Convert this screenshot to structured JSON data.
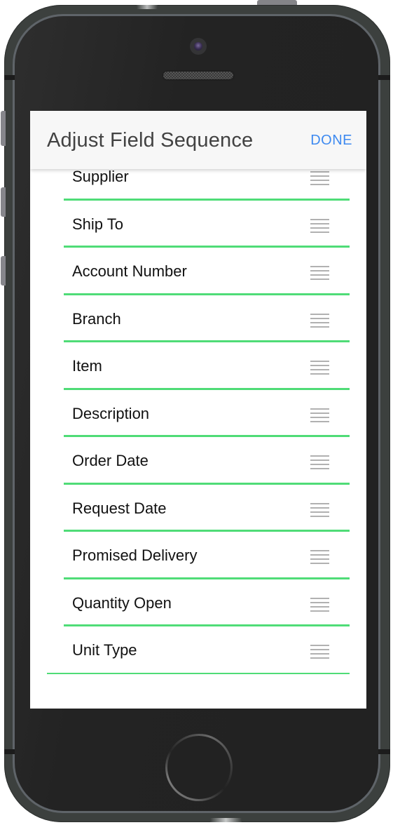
{
  "header": {
    "title": "Adjust Field Sequence",
    "done_label": "DONE"
  },
  "fields": [
    {
      "label": "Supplier"
    },
    {
      "label": "Ship To"
    },
    {
      "label": "Account Number"
    },
    {
      "label": "Branch"
    },
    {
      "label": "Item"
    },
    {
      "label": "Description"
    },
    {
      "label": "Order Date"
    },
    {
      "label": "Request Date"
    },
    {
      "label": "Promised Delivery"
    },
    {
      "label": "Quantity Open"
    },
    {
      "label": "Unit Type"
    }
  ],
  "icons": {
    "reorder_handle": "drag-handle-icon"
  },
  "colors": {
    "accent": "#3e8af0",
    "divider": "#4fdc77",
    "nav_background": "#f7f7f7",
    "title_text": "#424242",
    "handle": "#b1b1b1"
  }
}
